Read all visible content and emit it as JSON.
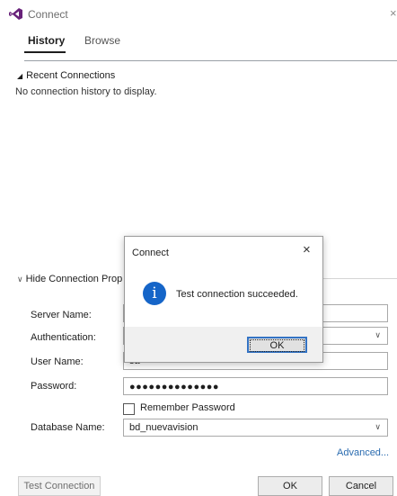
{
  "window": {
    "title": "Connect",
    "close_glyph": "×"
  },
  "tabs": [
    {
      "label": "History",
      "selected": true
    },
    {
      "label": "Browse",
      "selected": false
    }
  ],
  "recent": {
    "header": "Recent Connections",
    "empty_text": "No connection history to display."
  },
  "properties": {
    "header": "Hide Connection Prop",
    "server_name": {
      "label": "Server Name:",
      "value": ""
    },
    "authentication": {
      "label": "Authentication:",
      "value": ""
    },
    "user_name": {
      "label": "User Name:",
      "value": "sa"
    },
    "password": {
      "label": "Password:",
      "mask": "●●●●●●●●●●●●●●"
    },
    "remember_password": {
      "label": "Remember Password",
      "checked": false
    },
    "database_name": {
      "label": "Database Name:",
      "value": "bd_nuevavision"
    },
    "advanced_link": "Advanced..."
  },
  "buttons": {
    "test_connection": "Test Connection",
    "ok": "OK",
    "cancel": "Cancel"
  },
  "message_box": {
    "title": "Connect",
    "close_glyph": "×",
    "icon_glyph": "i",
    "icon": "info-icon",
    "text": "Test connection succeeded.",
    "ok": "OK"
  },
  "colors": {
    "accent": "#2b6cb0",
    "info_icon": "#1565c8",
    "logo": "#68217a"
  }
}
